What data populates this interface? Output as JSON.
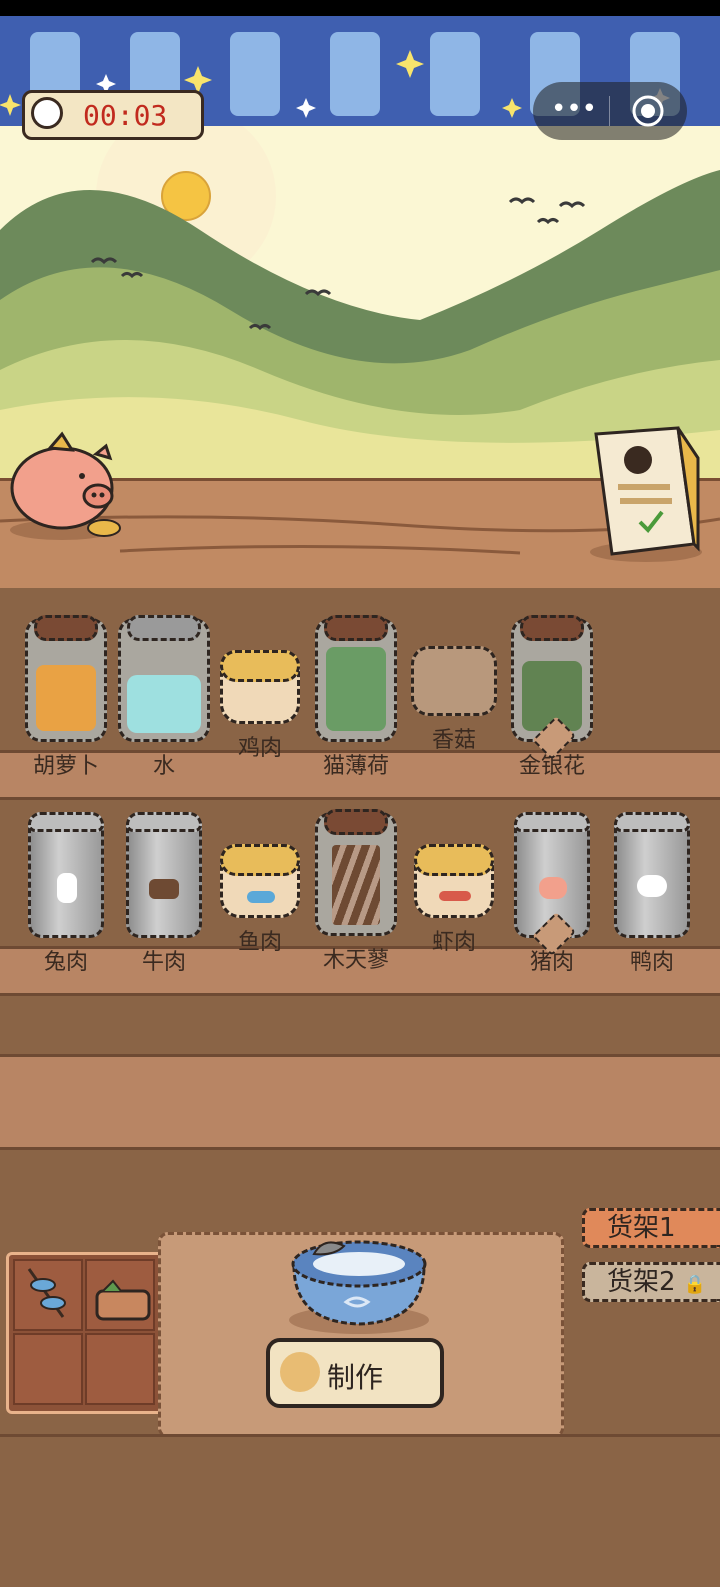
{
  "timer": {
    "value": "00:03",
    "icon": "clock-icon"
  },
  "capsule": {
    "more_icon": "more-dots-icon",
    "close_icon": "target-circle-icon"
  },
  "shelf_row_1": [
    {
      "label": "胡萝卜",
      "kind": "carrot-jar",
      "locked": false
    },
    {
      "label": "水",
      "kind": "water-jar",
      "locked": false
    },
    {
      "label": "鸡肉",
      "kind": "chicken-tin",
      "locked": false
    },
    {
      "label": "猫薄荷",
      "kind": "catnip-jar",
      "locked": false
    },
    {
      "label": "香菇",
      "kind": "mushroom-pile",
      "locked": false
    },
    {
      "label": "金银花",
      "kind": "honeysuckle-jar",
      "locked": true
    }
  ],
  "shelf_row_2": [
    {
      "label": "兔肉",
      "kind": "rabbit-can",
      "locked": false
    },
    {
      "label": "牛肉",
      "kind": "beef-can",
      "locked": false
    },
    {
      "label": "鱼肉",
      "kind": "fish-tin",
      "locked": false
    },
    {
      "label": "木天蓼",
      "kind": "silvervine-jar",
      "locked": false
    },
    {
      "label": "虾肉",
      "kind": "shrimp-tin",
      "locked": false
    },
    {
      "label": "猪肉",
      "kind": "pork-can",
      "locked": true
    },
    {
      "label": "鸭肉",
      "kind": "duck-can",
      "locked": false
    }
  ],
  "shelf_tabs": [
    {
      "label": "货架1",
      "active": true
    },
    {
      "label": "货架2",
      "active": false,
      "locked": true
    }
  ],
  "make_button": {
    "label": "制作"
  },
  "colors": {
    "accent": "#e0895a",
    "timer_text": "#c12a1e",
    "wood": "#c18a63"
  }
}
